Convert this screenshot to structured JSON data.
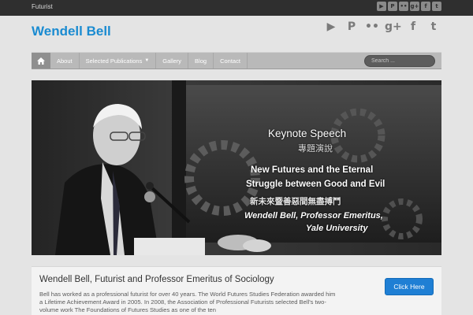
{
  "topbar": {
    "tagline": "Futurist"
  },
  "social_small": [
    {
      "icon": "youtube-icon",
      "glyph": "▶"
    },
    {
      "icon": "pinterest-icon",
      "glyph": "P"
    },
    {
      "icon": "flickr-icon",
      "glyph": "••"
    },
    {
      "icon": "google-plus-icon",
      "glyph": "g+"
    },
    {
      "icon": "facebook-icon",
      "glyph": "f"
    },
    {
      "icon": "twitter-icon",
      "glyph": "t"
    }
  ],
  "social_large": [
    {
      "icon": "youtube-icon",
      "glyph": "▶"
    },
    {
      "icon": "pinterest-icon",
      "glyph": "P"
    },
    {
      "icon": "flickr-icon",
      "glyph": "••"
    },
    {
      "icon": "google-plus-icon",
      "glyph": "g+"
    },
    {
      "icon": "facebook-icon",
      "glyph": "f"
    },
    {
      "icon": "twitter-icon",
      "glyph": "t"
    }
  ],
  "site_title": "Wendell Bell",
  "nav": {
    "items": [
      "About",
      "Selected Publications",
      "Gallery",
      "Blog",
      "Contact"
    ],
    "search_placeholder": "Search ..."
  },
  "hero": {
    "slide_lines": [
      "Keynote Speech",
      "專題演說",
      "New Futures and the Eternal",
      "Struggle between Good and Evil",
      "新未來暨善惡間無盡搏鬥",
      "Wendell Bell, Professor Emeritus,",
      "Yale University"
    ]
  },
  "content": {
    "heading": "Wendell Bell, Futurist and Professor Emeritus of Sociology",
    "body": "Bell has worked as a professional futurist for over 40 years. The World Futures Studies Federation awarded him a Lifetime Achievement Award in 2005. In 2008, the Association of Professional Futurists selected Bell's two-volume work The Foundations of Futures Studies as one of the ten",
    "cta_label": "Click Here"
  },
  "colors": {
    "brand": "#1a8bd1",
    "cta": "#1f7fd4",
    "nav_bg": "#b9b9b9",
    "topbar": "#2f2f2f"
  }
}
